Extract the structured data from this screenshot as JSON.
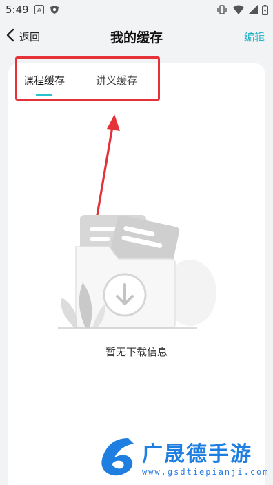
{
  "status_bar": {
    "time": "5:49",
    "left_icons": [
      "a-notification-icon",
      "shield-icon"
    ],
    "right_icons": [
      "vibrate-icon",
      "wifi-icon",
      "signal-icon",
      "battery-icon"
    ]
  },
  "nav": {
    "back_label": "返回",
    "title": "我的缓存",
    "edit_label": "编辑"
  },
  "tabs": [
    {
      "label": "课程缓存",
      "active": true
    },
    {
      "label": "讲义缓存",
      "active": false
    }
  ],
  "empty_state": {
    "message": "暂无下载信息",
    "icon": "download-folder-illustration"
  },
  "watermark": {
    "title": "广晟德手游",
    "url": "www.gsdtiepianji.com"
  },
  "colors": {
    "accent": "#29c3cf",
    "edit": "#1ab0c6",
    "annotation": "#e53238",
    "background": "#f2f3f5"
  }
}
